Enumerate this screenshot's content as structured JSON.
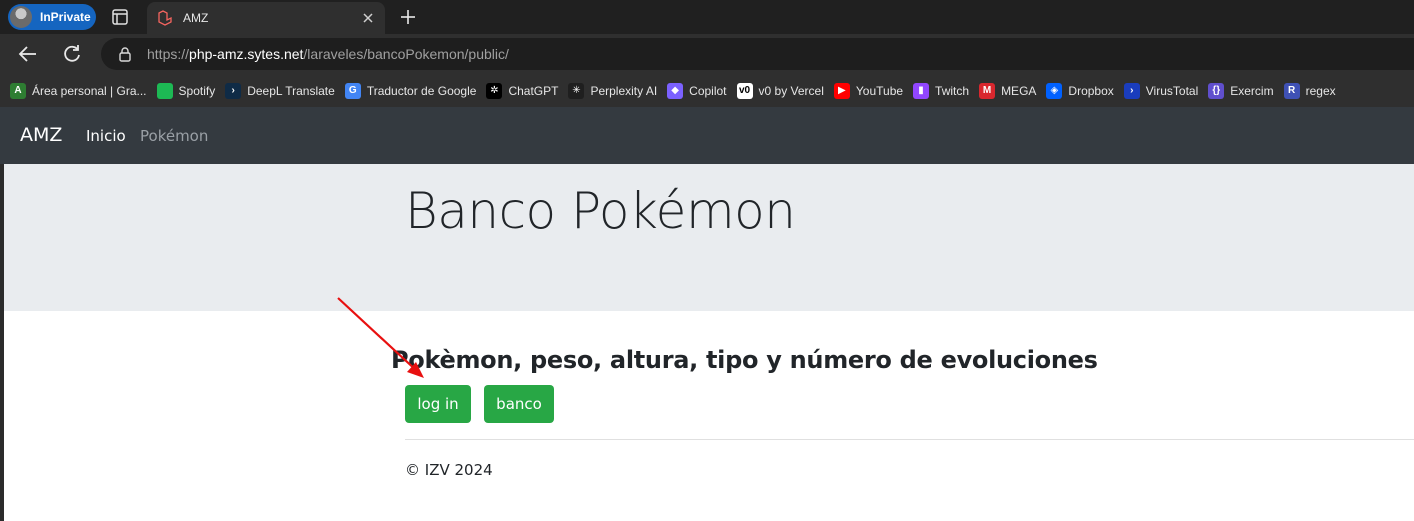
{
  "browser": {
    "profile_label": "InPrivate",
    "tab_title": "AMZ",
    "url_scheme": "https://",
    "url_host": "php-amz.sytes.net",
    "url_path": "/laraveles/bancoPokemon/public/"
  },
  "bookmarks": [
    {
      "label": "Área personal | Gra...",
      "icon": "A",
      "color": "#2e7d32"
    },
    {
      "label": "Spotify",
      "icon": "",
      "color": "#1db954"
    },
    {
      "label": "DeepL Translate",
      "icon": "›",
      "color": "#0f2b46"
    },
    {
      "label": "Traductor de Google",
      "icon": "G",
      "color": "#4285f4"
    },
    {
      "label": "ChatGPT",
      "icon": "✲",
      "color": "#000000"
    },
    {
      "label": "Perplexity AI",
      "icon": "✳",
      "color": "#1f1f1f"
    },
    {
      "label": "Copilot",
      "icon": "◆",
      "color": "#7b61ff"
    },
    {
      "label": "v0 by Vercel",
      "icon": "v0",
      "color": "#ffffff"
    },
    {
      "label": "YouTube",
      "icon": "▶",
      "color": "#ff0000"
    },
    {
      "label": "Twitch",
      "icon": "▮",
      "color": "#9146ff"
    },
    {
      "label": "MEGA",
      "icon": "M",
      "color": "#d9272e"
    },
    {
      "label": "Dropbox",
      "icon": "◈",
      "color": "#0061ff"
    },
    {
      "label": "VirusTotal",
      "icon": "›",
      "color": "#1a3dbd"
    },
    {
      "label": "Exercim",
      "icon": "{}",
      "color": "#604fcd"
    },
    {
      "label": "regex",
      "icon": "R",
      "color": "#3f51b5"
    }
  ],
  "navbar": {
    "brand": "AMZ",
    "links": [
      "Inicio",
      "Pokémon"
    ]
  },
  "jumbotron": {
    "title": "Banco Pokémon"
  },
  "content": {
    "subtitle": "Pokèmon, peso, altura, tipo y número de evoluciones",
    "buttons": [
      "log in",
      "banco"
    ]
  },
  "footer": {
    "text": "© IZV 2024"
  },
  "colors": {
    "navbar": "#343a40",
    "jumbotron": "#e9ecef",
    "button": "#28a745",
    "annotation_arrow": "#e81010"
  }
}
